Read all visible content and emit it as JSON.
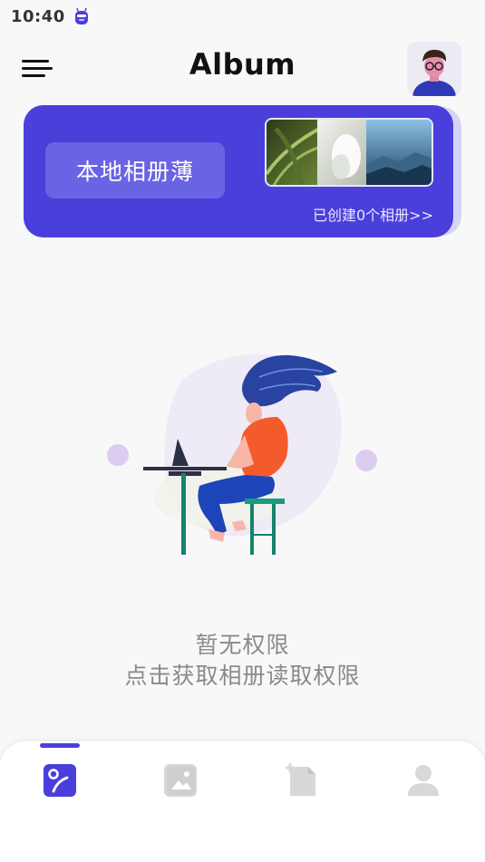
{
  "status_bar": {
    "time": "10:40"
  },
  "app_bar": {
    "title": "Album"
  },
  "banner": {
    "button_label": "本地相册薄",
    "subtitle": "已创建0个相册>>"
  },
  "empty_state": {
    "title": "暂无权限",
    "action_text": "点击获取相册读取权限"
  },
  "bottom_nav": {
    "items": [
      {
        "icon": "album-icon",
        "active": true
      },
      {
        "icon": "photo-icon",
        "active": false
      },
      {
        "icon": "new-file-icon",
        "active": false
      },
      {
        "icon": "profile-icon",
        "active": false
      }
    ]
  },
  "colors": {
    "accent": "#4a3fdb",
    "background": "#f8f8f8",
    "muted_text": "#8a8a8a"
  }
}
